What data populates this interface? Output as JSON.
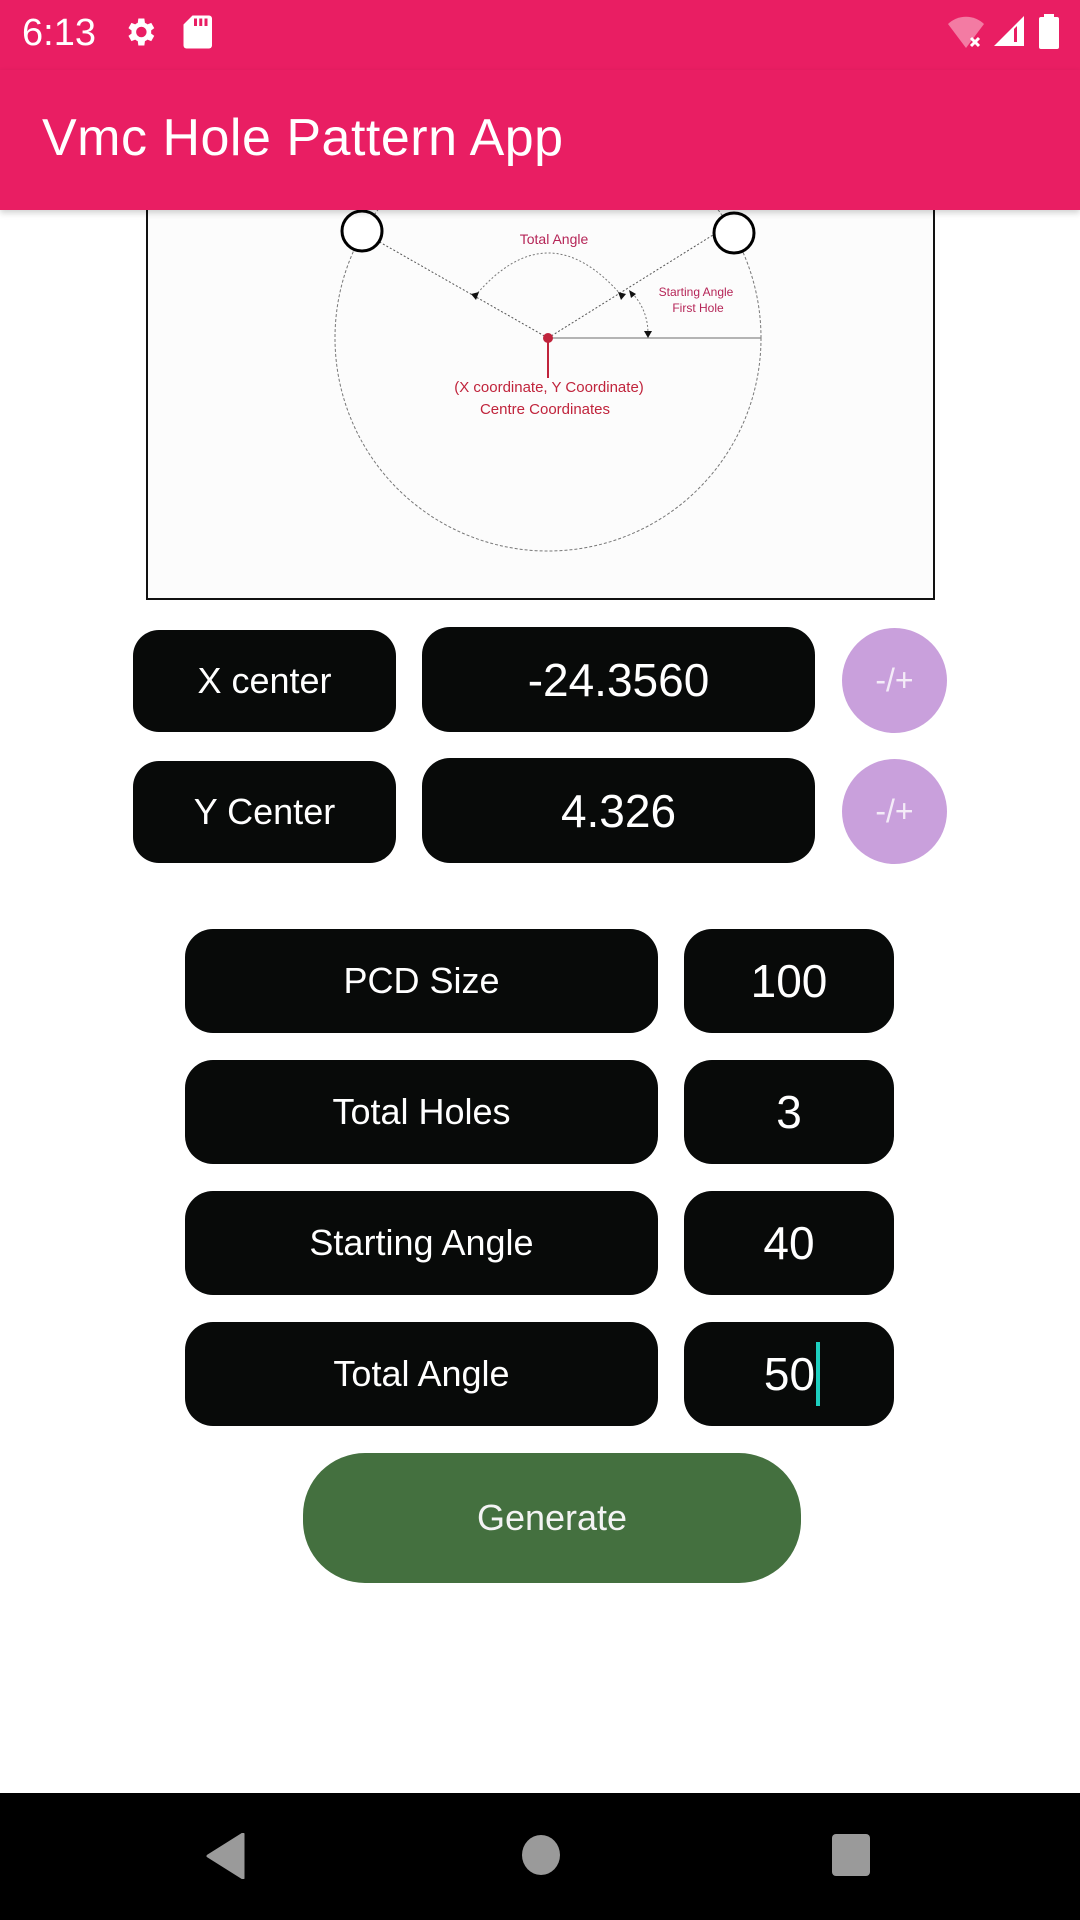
{
  "status_bar": {
    "time": "6:13",
    "left_icons": [
      "settings-gear-icon",
      "sd-card-icon"
    ],
    "right_icons": [
      "wifi-off-icon",
      "cellular-signal-icon",
      "battery-icon"
    ]
  },
  "app_bar": {
    "title": "Vmc Hole Pattern App"
  },
  "diagram": {
    "total_angle_label": "Total Angle",
    "starting_angle_label_line1": "Starting Angle",
    "starting_angle_label_line2": "First Hole",
    "center_label_line1": "(X coordinate, Y Coordinate)",
    "center_label_line2": "Centre Coordinates",
    "accent_color": "#C0243C"
  },
  "center_inputs": [
    {
      "label": "X center",
      "value": "-24.3560",
      "toggle_label": "-/+"
    },
    {
      "label": "Y Center",
      "value": "4.326",
      "toggle_label": "-/+"
    }
  ],
  "params": [
    {
      "label": "PCD Size",
      "value": "100"
    },
    {
      "label": "Total Holes",
      "value": "3"
    },
    {
      "label": "Starting Angle",
      "value": "40"
    },
    {
      "label": "Total Angle",
      "value": "50",
      "focused": true
    }
  ],
  "generate_button": {
    "label": "Generate",
    "color": "#44703F"
  },
  "colors": {
    "app_bar": "#E91E63",
    "field_bg": "#080A09",
    "toggle_bg": "#C9A0DC",
    "cursor": "#1DCFBF"
  },
  "nav_bar": {
    "buttons": [
      "back-icon",
      "home-icon",
      "recents-icon"
    ]
  }
}
